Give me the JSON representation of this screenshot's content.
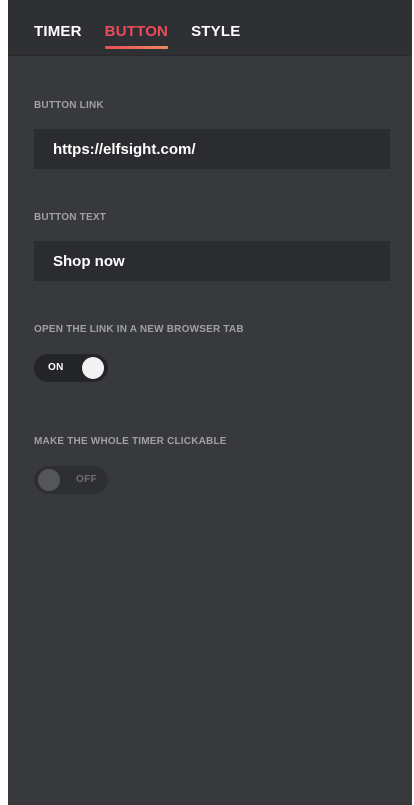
{
  "tabs": [
    {
      "label": "TIMER",
      "active": false
    },
    {
      "label": "BUTTON",
      "active": true
    },
    {
      "label": "STYLE",
      "active": false
    }
  ],
  "button_link": {
    "label": "BUTTON LINK",
    "value": "https://elfsight.com/"
  },
  "button_text": {
    "label": "BUTTON TEXT",
    "value": "Shop now"
  },
  "new_tab": {
    "label": "OPEN THE LINK IN A NEW BROWSER TAB",
    "state": "ON",
    "enabled": true
  },
  "whole_clickable": {
    "label": "MAKE THE WHOLE TIMER CLICKABLE",
    "state": "OFF",
    "enabled": false
  },
  "colors": {
    "accent": "#ea4b5a",
    "panel_bg": "#38393c",
    "input_bg": "#2b2c2f"
  }
}
